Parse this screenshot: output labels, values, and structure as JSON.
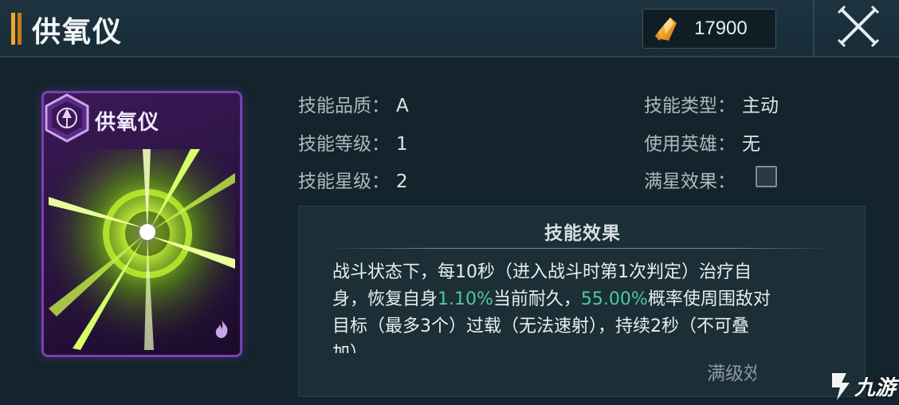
{
  "header": {
    "title": "供氧仪",
    "currency_value": "17900",
    "currency_icon": "crystal-icon",
    "close_icon": "close-icon"
  },
  "card": {
    "name": "供氧仪",
    "rarity_icon": "hexagon-emblem-icon",
    "corner_icon": "flame-icon",
    "frame_color": "#7d3fb1"
  },
  "info": {
    "quality_label": "技能品质：",
    "quality_value": "A",
    "level_label": "技能等级：",
    "level_value": "1",
    "star_label": "技能星级：",
    "star_value": "2",
    "type_label": "技能类型：",
    "type_value": "主动",
    "hero_label": "使用英雄：",
    "hero_value": "无",
    "fullstar_label": "满星效果："
  },
  "effect": {
    "title": "技能效果",
    "line1": "战斗状态下，每10秒（进入战斗时第1次判定）治疗自",
    "line2_a": "身，恢复自身",
    "line2_hl1": "1.10%",
    "line2_b": "当前耐久，",
    "line2_hl2": "55.00%",
    "line2_c": "概率使周围敌对",
    "line3": "目标（最多3个）过载（无法速射），持续2秒（不可叠",
    "line4": "加）",
    "highlight_color": "#4fc7a3",
    "max_level_label": "满级效"
  },
  "watermark": {
    "text": "九游",
    "icon": "jiuyou-logo-icon"
  }
}
